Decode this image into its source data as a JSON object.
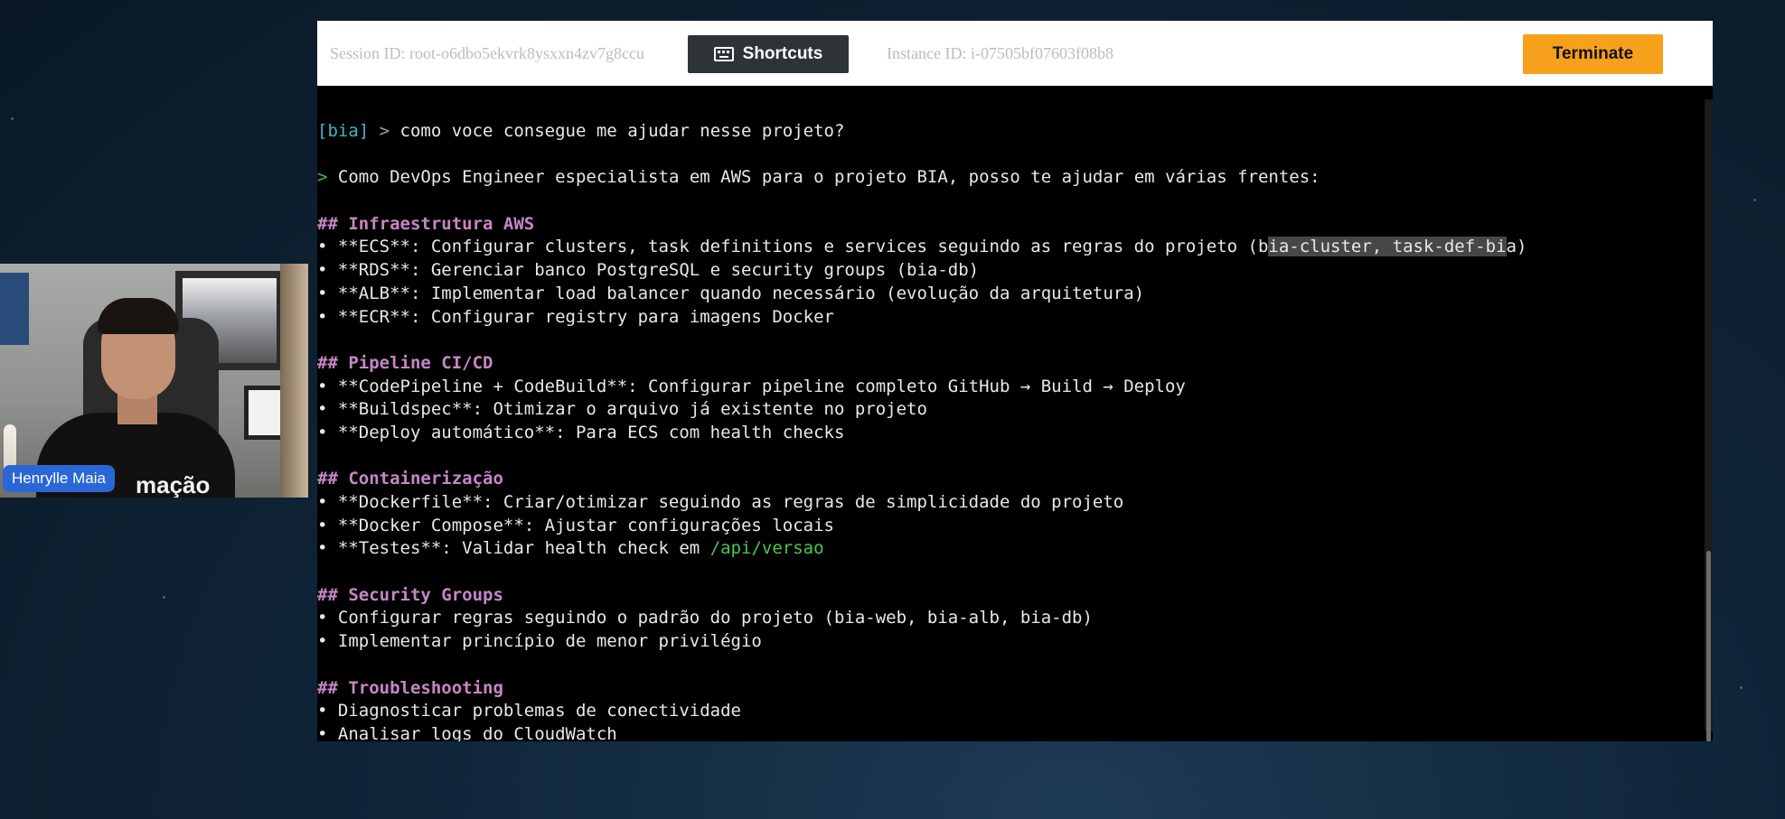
{
  "topbar": {
    "session_label": "Session ID: root-o6dbo5ekvrk8ysxxn4zv7g8ccu",
    "shortcuts_label": "Shortcuts",
    "instance_label": "Instance ID: i-07505bf07603f08b8",
    "terminate_label": "Terminate"
  },
  "webcam": {
    "name": "Henrylle Maia",
    "shirt_text": "mação"
  },
  "terminal": {
    "prompt_tag": "[bia]",
    "prompt_arrow": " > ",
    "user_input": "como voce consegue me ajudar nesse projeto?",
    "response_arrow": "> ",
    "intro": "Como DevOps Engineer especialista em AWS para o projeto BIA, posso te ajudar em várias frentes:",
    "sections": [
      {
        "heading": "## Infraestrutura AWS"
      },
      {
        "heading": "## Pipeline CI/CD"
      },
      {
        "heading": "## Containerização"
      },
      {
        "heading": "## Security Groups"
      },
      {
        "heading": "## Troubleshooting"
      }
    ],
    "l_ecs_pre": "• **ECS**: Configurar clusters, task definitions e services seguindo as regras do projeto (",
    "l_ecs_sel1": "b",
    "l_ecs_sel_pre": "",
    "l_ecs_hl": "ia-cluster, task-def-bi",
    "l_ecs_post": "a)",
    "l_rds": "• **RDS**: Gerenciar banco PostgreSQL e security groups (bia-db)",
    "l_alb": "• **ALB**: Implementar load balancer quando necessário (evolução da arquitetura)",
    "l_ecr": "• **ECR**: Configurar registry para imagens Docker",
    "l_codepipeline": "• **CodePipeline + CodeBuild**: Configurar pipeline completo GitHub → Build → Deploy",
    "l_buildspec": "• **Buildspec**: Otimizar o arquivo já existente no projeto",
    "l_deploy": "• **Deploy automático**: Para ECS com health checks",
    "l_dockerfile": "• **Dockerfile**: Criar/otimizar seguindo as regras de simplicidade do projeto",
    "l_compose": "• **Docker Compose**: Ajustar configurações locais",
    "l_testes_pre": "• **Testes**: Validar health check em ",
    "l_testes_path": "/api/versao",
    "l_sg1": "• Configurar regras seguindo o padrão do projeto (bia-web, bia-alb, bia-db)",
    "l_sg2": "• Implementar princípio de menor privilégio",
    "l_ts1": "• Diagnosticar problemas de conectividade",
    "l_ts2": "• Analisar logs do CloudWatch"
  }
}
